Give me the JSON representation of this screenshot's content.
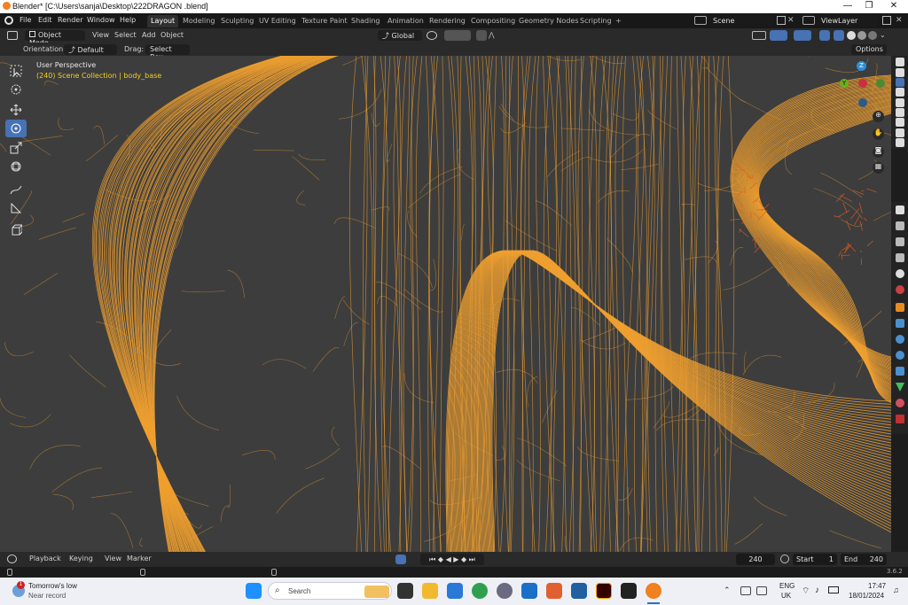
{
  "titlebar": {
    "title": "Blender* [C:\\Users\\sanja\\Desktop\\222DRAGON .blend]",
    "minimize": "—",
    "restore": "❐",
    "close": "✕"
  },
  "menubar": {
    "menus": [
      "File",
      "Edit",
      "Render",
      "Window",
      "Help"
    ],
    "workspaces": [
      "Layout",
      "Modeling",
      "Sculpting",
      "UV Editing",
      "Texture Paint",
      "Shading",
      "Animation",
      "Rendering",
      "Compositing",
      "Geometry Nodes",
      "Scripting"
    ],
    "active_workspace": "Layout",
    "add_tab": "+",
    "scene_name": "Scene",
    "view_layer": "ViewLayer"
  },
  "header": {
    "mode": "Object Mode",
    "menus": [
      "View",
      "Select",
      "Add",
      "Object"
    ],
    "transform_orientation": "Global",
    "options": "Options"
  },
  "tool_settings": {
    "orientation_label": "Orientation:",
    "orientation_value": "Default",
    "drag_label": "Drag:",
    "drag_value": "Select Box"
  },
  "viewport": {
    "view_name": "User Perspective",
    "collection_info": "(240) Scene Collection | body_base",
    "gizmo_axes": {
      "z": "Z",
      "y": "Y",
      "x": "X"
    },
    "wire_color": "#f0a030",
    "background": "#3d3d3d"
  },
  "timeline": {
    "menus": [
      "Playback",
      "Keying",
      "View",
      "Marker"
    ],
    "current_frame": "240",
    "start_label": "Start",
    "start_value": "1",
    "end_label": "End",
    "end_value": "240"
  },
  "statusbar": {
    "version": "3.6.2"
  },
  "taskbar": {
    "weather_title": "Tomorrow's low",
    "weather_sub": "Near record",
    "notification_count": "1",
    "search_placeholder": "Search",
    "language": "ENG",
    "region": "UK",
    "time": "17:47",
    "date": "18/01/2024"
  },
  "colors": {
    "accent": "#4772b3",
    "wireframe": "#f0a030",
    "selection_highlight": "#e05a20"
  }
}
